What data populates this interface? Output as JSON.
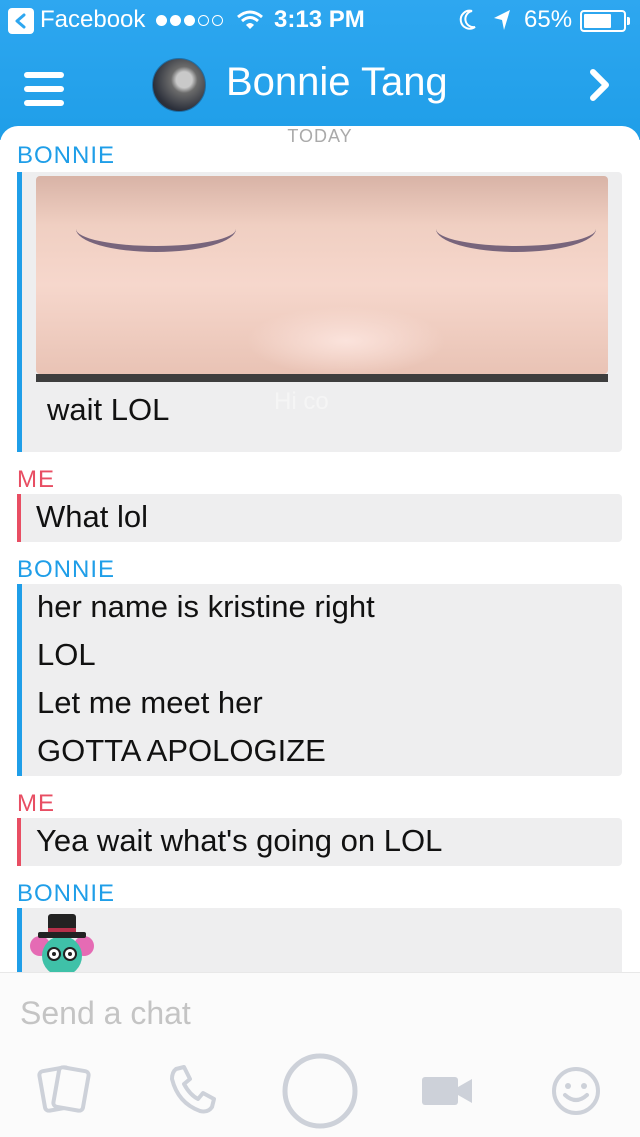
{
  "status_bar": {
    "back_app": "Facebook",
    "time": "3:13 PM",
    "battery": "65%"
  },
  "header": {
    "title": "Bonnie Tang"
  },
  "chat": {
    "date_divider": "TODAY",
    "messages": [
      {
        "sender": "BONNIE",
        "lines": [
          "wait LOL"
        ],
        "media_overlay_text": "Hi co"
      },
      {
        "sender": "ME",
        "lines": [
          "What lol"
        ]
      },
      {
        "sender": "BONNIE",
        "lines": [
          "her name is kristine right",
          "LOL",
          "Let me meet her",
          "GOTTA APOLOGIZE"
        ]
      },
      {
        "sender": "ME",
        "lines": [
          "Yea wait what's going on LOL"
        ]
      },
      {
        "sender": "BONNIE",
        "lines": []
      }
    ]
  },
  "composer": {
    "placeholder": "Send a chat"
  },
  "icons": {
    "back": "chevron-left-icon",
    "menu": "hamburger-menu-icon",
    "forward": "chevron-right-icon",
    "toolbar": [
      "cards-icon",
      "phone-icon",
      "capture-icon",
      "video-icon",
      "smiley-icon"
    ]
  },
  "colors": {
    "accent_blue": "#1f9ee8",
    "me_red": "#e84e63",
    "bubble_bg": "#eeeeef"
  }
}
